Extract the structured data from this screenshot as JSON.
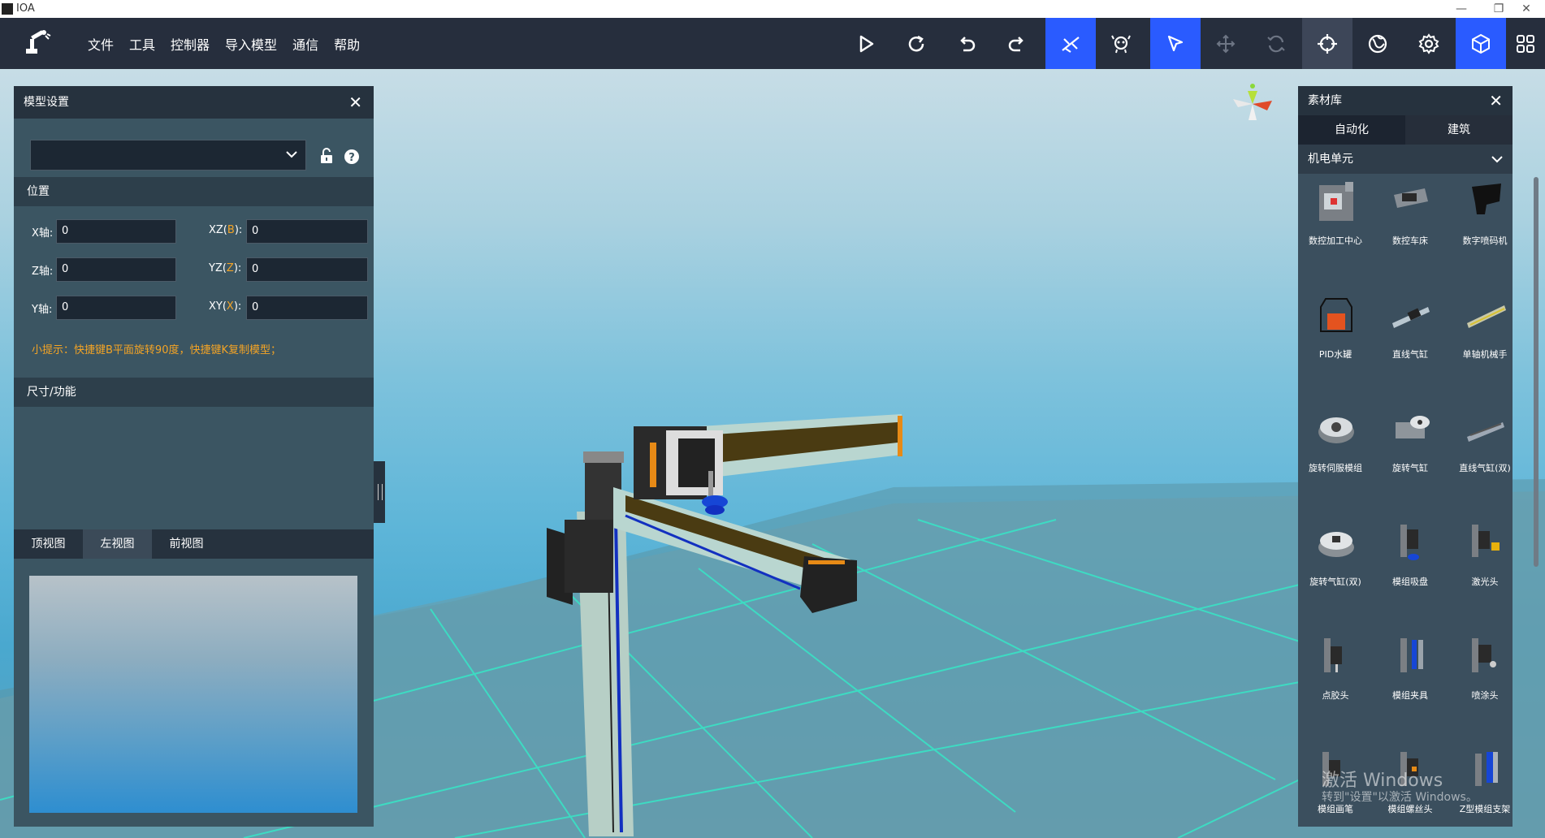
{
  "window": {
    "title": "IOA",
    "minimize": "—",
    "restore": "❐",
    "close": "✕"
  },
  "menu": [
    "文件",
    "工具",
    "控制器",
    "导入模型",
    "通信",
    "帮助"
  ],
  "toolbar_icons": [
    "play-icon",
    "refresh-icon",
    "undo-icon",
    "redo-icon",
    "fly-mode-icon",
    "robot-icon",
    "pointer-icon",
    "move-icon",
    "rotate-icon",
    "crosshair-icon",
    "globe-icon",
    "settings-icon",
    "cube-icon",
    "grid-icon"
  ],
  "colors": {
    "accent": "#2a5bff",
    "hint": "#f4a425",
    "toolbar": "#262e3d"
  },
  "left_panel": {
    "title": "模型设置",
    "close": "✕",
    "section_position": "位置",
    "fields": {
      "x": {
        "label": "X轴:",
        "value": "0"
      },
      "z": {
        "label": "Z轴:",
        "value": "0"
      },
      "y": {
        "label": "Y轴:",
        "value": "0"
      },
      "xz": {
        "label_pre": "XZ(",
        "hotkey": "B",
        "label_post": "):",
        "value": "0"
      },
      "yz": {
        "label_pre": "YZ(",
        "hotkey": "Z",
        "label_post": "):",
        "value": "0"
      },
      "xy": {
        "label_pre": "XY(",
        "hotkey": "X",
        "label_post": "):",
        "value": "0"
      }
    },
    "hint": "小提示：快捷键B平面旋转90度，快捷键K复制模型；",
    "section_size": "尺寸/功能",
    "view_tabs": [
      "顶视图",
      "左视图",
      "前视图"
    ],
    "active_view_tab": "左视图"
  },
  "right_panel": {
    "title": "素材库",
    "close": "✕",
    "tabs": [
      "自动化",
      "建筑"
    ],
    "active_tab": "自动化",
    "category": "机电单元",
    "items": [
      "数控加工中心",
      "数控车床",
      "数字喷码机",
      "PID水罐",
      "直线气缸",
      "单轴机械手",
      "旋转伺服模组",
      "旋转气缸",
      "直线气缸(双)",
      "旋转气缸(双)",
      "模组吸盘",
      "激光头",
      "点胶头",
      "模组夹具",
      "喷涂头",
      "模组画笔",
      "模组螺丝头",
      "Z型模组支架"
    ]
  },
  "watermark": {
    "line1": "激活 Windows",
    "line2": "转到\"设置\"以激活 Windows。"
  }
}
